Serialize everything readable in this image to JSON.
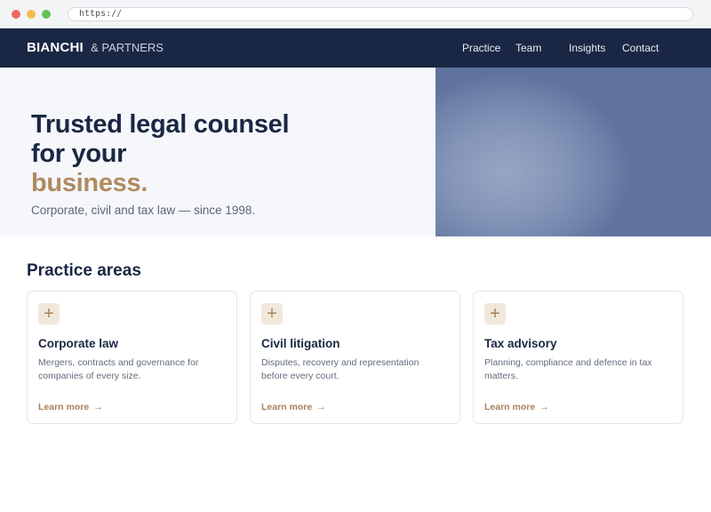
{
  "browser": {
    "url": "https://"
  },
  "nav": {
    "brand_main": "BIANCHI",
    "brand_sub": "& PARTNERS",
    "links": [
      {
        "label": "Practice"
      },
      {
        "label": "Team"
      },
      {
        "label": "Insights"
      },
      {
        "label": "Contact"
      }
    ]
  },
  "hero": {
    "title_line": "Trusted legal counsel for your",
    "title_accent": "business.",
    "subtitle": "Corporate, civil and tax law — since 1998."
  },
  "practice": {
    "title": "Practice areas",
    "cards": [
      {
        "icon": "+",
        "title": "Corporate law",
        "description": "Mergers, contracts and governance for companies of every size.",
        "link_label": "Learn more",
        "link_arrow": "→"
      },
      {
        "icon": "+",
        "title": "Civil litigation",
        "description": "Disputes, recovery and representation before every court.",
        "link_label": "Learn more",
        "link_arrow": "→"
      },
      {
        "icon": "+",
        "title": "Tax advisory",
        "description": "Planning, compliance and defence in tax matters.",
        "link_label": "Learn more",
        "link_arrow": "→"
      }
    ]
  },
  "colors": {
    "navy": "#1a2744",
    "accent": "#b08a5f",
    "hero_bg": "#f5f7fb"
  }
}
